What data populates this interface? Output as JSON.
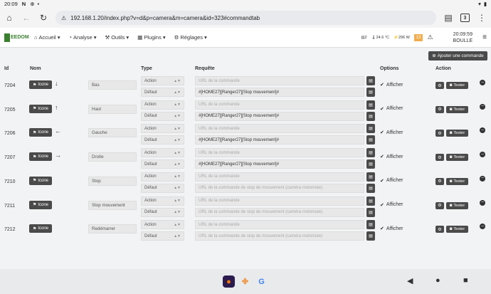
{
  "status": {
    "time": "20:09",
    "icons": [
      "N",
      "◎",
      "·"
    ]
  },
  "browser": {
    "url": "192.168.1.20/index.php?v=d&p=camera&m=camera&id=323#commandtab",
    "tabs": "3"
  },
  "nav": {
    "logo": "EEDOM",
    "menu": [
      {
        "label": "Accueil",
        "icon": "⌂"
      },
      {
        "label": "Analyse",
        "icon": "◔"
      },
      {
        "label": "Outils",
        "icon": "⚒"
      },
      {
        "label": "Plugins",
        "icon": "▦"
      },
      {
        "label": "Réglages",
        "icon": "⚙"
      }
    ],
    "stats": {
      "a": "2",
      "temp": "24.6 °C",
      "power": "296 W",
      "alerts": "13"
    },
    "clock": "20:09:59",
    "user": "BOULLE"
  },
  "add_button": "Ajouter une commande",
  "columns": {
    "id": "Id",
    "nom": "Nom",
    "type": "Type",
    "requete": "Requête",
    "options": "Options",
    "action": "Action"
  },
  "labels": {
    "icone": "Icone",
    "afficher": "Afficher",
    "tester": "Tester",
    "action": "Action",
    "defaut": "Défaut",
    "url_ph": "URL de la commande"
  },
  "rows": [
    {
      "id": "7204",
      "arrow": "↓",
      "name": "Bas",
      "req2": "#[HOME27][Ranger27][Stop mouvement]#",
      "ph2": false
    },
    {
      "id": "7205",
      "arrow": "↑",
      "name": "Haut",
      "req2": "#[HOME27][Ranger27][Stop mouvement]#",
      "ph2": false
    },
    {
      "id": "7206",
      "arrow": "←",
      "name": "Gauche",
      "req2": "#[HOME27][Ranger27][Stop mouvement]#",
      "ph2": false
    },
    {
      "id": "7207",
      "arrow": "→",
      "name": "Droite",
      "req2": "#[HOME27][Ranger27][Stop mouvement]#",
      "ph2": false
    },
    {
      "id": "7210",
      "arrow": "",
      "name": "Stop",
      "req2": "URL de la commande de stop de mouvement (caméra motorisée)",
      "ph2": true
    },
    {
      "id": "7211",
      "arrow": "",
      "name": "Stop mouvement",
      "req2": "URL de la commande de stop de mouvement (caméra motorisée)",
      "ph2": true
    },
    {
      "id": "7212",
      "arrow": "",
      "name": "Redémarrer",
      "req2": "URL de la commande de stop de mouvement (caméra motorisée)",
      "ph2": true
    }
  ],
  "dock": [
    "firefox",
    "pinwheel",
    "google"
  ]
}
